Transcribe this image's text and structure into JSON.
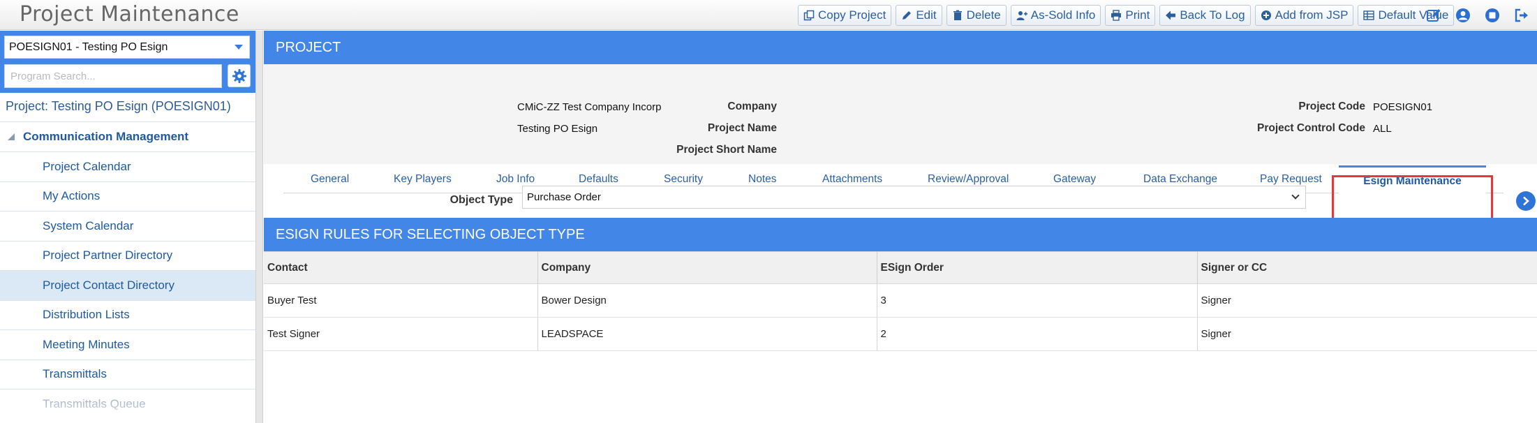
{
  "app": {
    "title": "Project Maintenance"
  },
  "toolbar": {
    "buttons": [
      {
        "label": "Copy Project",
        "icon": "copy-icon"
      },
      {
        "label": "Edit",
        "icon": "pencil-icon"
      },
      {
        "label": "Delete",
        "icon": "trash-icon"
      },
      {
        "label": "As-Sold Info",
        "icon": "user-plus-icon"
      },
      {
        "label": "Print",
        "icon": "print-icon"
      },
      {
        "label": "Back To Log",
        "icon": "arrow-left-icon"
      },
      {
        "label": "Add from JSP",
        "icon": "plus-circle-icon"
      },
      {
        "label": "Default Value",
        "icon": "table-icon"
      }
    ],
    "icons": [
      "edit-square-icon",
      "user-circle-icon",
      "stop-icon",
      "logout-icon"
    ]
  },
  "sidebar": {
    "project_select": "POESIGN01 - Testing PO Esign",
    "search_placeholder": "Program Search...",
    "project_link": "Project: Testing PO Esign (POESIGN01)",
    "section": "Communication Management",
    "items": [
      {
        "label": "Project Calendar"
      },
      {
        "label": "My Actions"
      },
      {
        "label": "System Calendar"
      },
      {
        "label": "Project Partner Directory"
      },
      {
        "label": "Project Contact Directory",
        "selected": true
      },
      {
        "label": "Distribution Lists"
      },
      {
        "label": "Meeting Minutes"
      },
      {
        "label": "Transmittals"
      },
      {
        "label": "Transmittals Queue"
      }
    ]
  },
  "project": {
    "header": "PROJECT",
    "fields": {
      "company_label": "Company",
      "company_value": "CMiC-ZZ Test Company Incorp",
      "project_name_label": "Project Name",
      "project_name_value": "Testing PO Esign",
      "short_name_label": "Project Short Name",
      "short_name_value": "",
      "project_code_label": "Project Code",
      "project_code_value": "POESIGN01",
      "control_code_label": "Project Control Code",
      "control_code_value": "ALL"
    }
  },
  "tabs": [
    {
      "label": "General"
    },
    {
      "label": "Key Players"
    },
    {
      "label": "Job Info"
    },
    {
      "label": "Defaults"
    },
    {
      "label": "Security"
    },
    {
      "label": "Notes"
    },
    {
      "label": "Attachments"
    },
    {
      "label": "Review/Approval"
    },
    {
      "label": "Gateway"
    },
    {
      "label": "Data Exchange"
    },
    {
      "label": "Pay Request"
    },
    {
      "label": "Esign Maintenance",
      "active": true
    }
  ],
  "object_type": {
    "label": "Object Type",
    "value": "Purchase Order"
  },
  "rules": {
    "header": "ESIGN RULES FOR SELECTING OBJECT TYPE",
    "columns": [
      "Contact",
      "Company",
      "ESign Order",
      "Signer or CC"
    ],
    "rows": [
      [
        "Buyer Test",
        "Bower Design",
        "3",
        "Signer"
      ],
      [
        "Test Signer",
        "LEADSPACE",
        "2",
        "Signer"
      ]
    ]
  },
  "colors": {
    "accent": "#4287e8",
    "link": "#1f5aa0",
    "highlight": "#e03a3a"
  }
}
